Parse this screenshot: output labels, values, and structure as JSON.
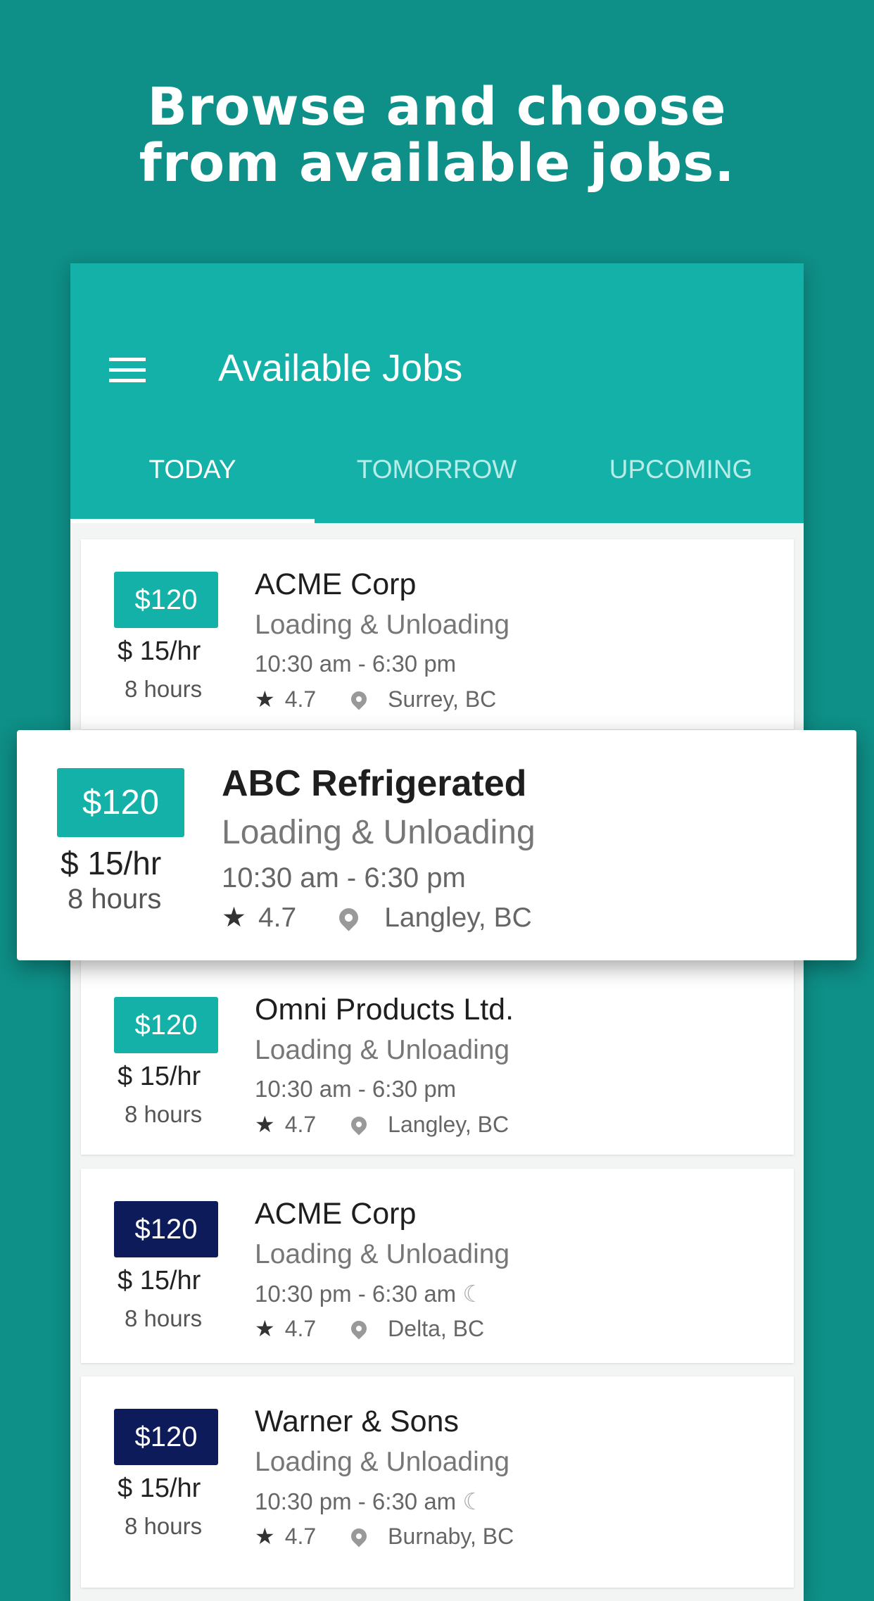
{
  "headline": {
    "line1": "Browse and choose",
    "line2": "from available jobs."
  },
  "appbar": {
    "title": "Available Jobs",
    "menu_icon": "hamburger-icon"
  },
  "tabs": [
    {
      "label": "TODAY",
      "active": true
    },
    {
      "label": "TOMORROW",
      "active": false
    },
    {
      "label": "UPCOMING",
      "active": false
    }
  ],
  "colors": {
    "background": "#0e8f87",
    "appbar": "#14b1a8",
    "day_badge": "#14b1a8",
    "night_badge": "#0d1b5a"
  },
  "jobs": [
    {
      "pay": "$120",
      "rate": "$ 15/hr",
      "hours": "8 hours",
      "company": "ACME Corp",
      "category": "Loading & Unloading",
      "time": "10:30 am - 6:30 pm",
      "night": false,
      "rating": "4.7",
      "location": "Surrey, BC"
    },
    {
      "pay": "$120",
      "rate": "$ 15/hr",
      "hours": "8 hours",
      "company": "ABC Refrigerated",
      "category": "Loading & Unloading",
      "time": "10:30 am - 6:30 pm",
      "night": false,
      "rating": "4.7",
      "location": "Langley, BC"
    },
    {
      "pay": "$120",
      "rate": "$ 15/hr",
      "hours": "8 hours",
      "company": "Omni Products Ltd.",
      "category": "Loading & Unloading",
      "time": "10:30 am - 6:30 pm",
      "night": false,
      "rating": "4.7",
      "location": "Langley, BC"
    },
    {
      "pay": "$120",
      "rate": "$ 15/hr",
      "hours": "8 hours",
      "company": "ACME Corp",
      "category": "Loading & Unloading",
      "time": "10:30 pm - 6:30 am",
      "night": true,
      "rating": "4.7",
      "location": "Delta, BC"
    },
    {
      "pay": "$120",
      "rate": "$ 15/hr",
      "hours": "8 hours",
      "company": "Warner & Sons",
      "category": "Loading & Unloading",
      "time": "10:30 pm - 6:30 am",
      "night": true,
      "rating": "4.7",
      "location": "Burnaby, BC"
    }
  ]
}
